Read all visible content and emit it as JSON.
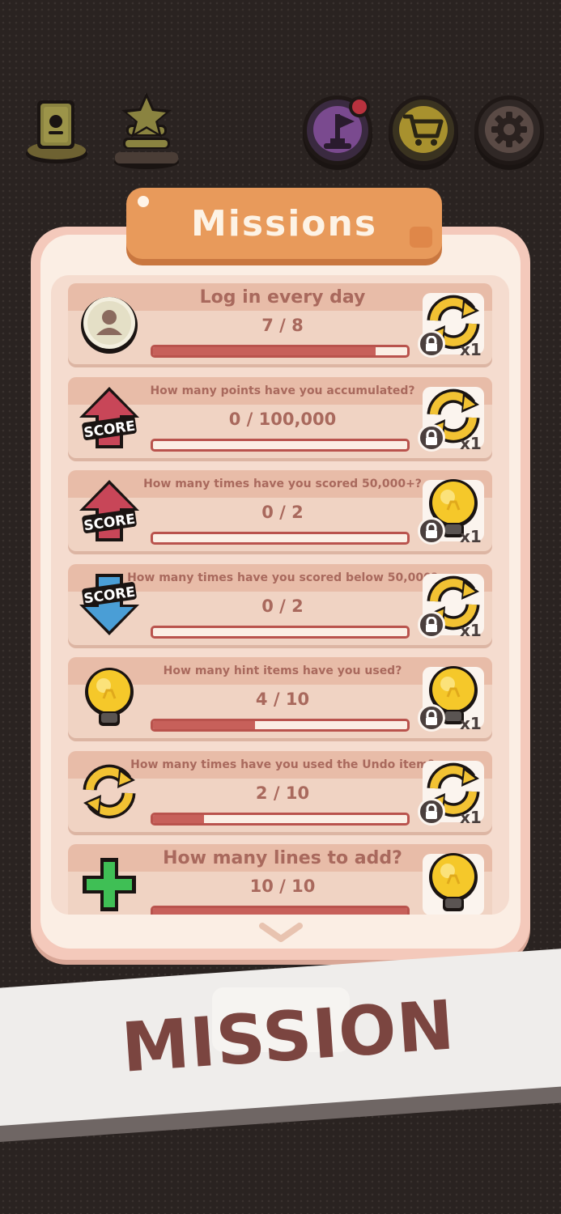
{
  "header": {
    "icons": [
      "profile-card-icon",
      "leaderboard-icon",
      "missions-flag-icon",
      "shop-cart-icon",
      "settings-gear-icon"
    ]
  },
  "panel": {
    "title": "Missions"
  },
  "missions": [
    {
      "label": "Log in every day",
      "label_size": "big",
      "progress": "7 / 8",
      "fraction": 0.875,
      "icon": "profile-icon",
      "reward_icon": "undo-icon",
      "reward_qty": "x1",
      "locked": true
    },
    {
      "label": "How many points have you accumulated?",
      "label_size": "small",
      "progress": "0 / 100,000",
      "fraction": 0,
      "icon": "score-up-arrow-icon",
      "reward_icon": "undo-icon",
      "reward_qty": "x1",
      "locked": true
    },
    {
      "label": "How many times have you scored 50,000+?",
      "label_size": "small",
      "progress": "0 / 2",
      "fraction": 0,
      "icon": "score-up-arrow-icon",
      "reward_icon": "hint-bulb-icon",
      "reward_qty": "x1",
      "locked": true
    },
    {
      "label": "How many times have you scored below 50,000?",
      "label_size": "small",
      "progress": "0 / 2",
      "fraction": 0,
      "icon": "score-down-arrow-icon",
      "reward_icon": "undo-icon",
      "reward_qty": "x1",
      "locked": true
    },
    {
      "label": "How many hint items have you used?",
      "label_size": "small",
      "progress": "4 / 10",
      "fraction": 0.4,
      "icon": "hint-bulb-icon",
      "reward_icon": "hint-bulb-icon",
      "reward_qty": "x1",
      "locked": true
    },
    {
      "label": "How many times have you used the Undo item?",
      "label_size": "small",
      "progress": "2 / 10",
      "fraction": 0.2,
      "icon": "undo-icon",
      "reward_icon": "undo-icon",
      "reward_qty": "x1",
      "locked": true
    },
    {
      "label": "How many lines to add?",
      "label_size": "big",
      "progress": "10 / 10",
      "fraction": 1,
      "icon": "add-line-plus-icon",
      "reward_icon": "hint-bulb-icon",
      "reward_qty": "",
      "locked": false
    }
  ],
  "banner": {
    "text": "MISSION"
  },
  "colors": {
    "background": "#2a2321",
    "panel": "#f4c9bb",
    "title_tab": "#e89a5b",
    "text": "#a9695d",
    "progress_fill": "#c7605a",
    "banner_text": "#7b4540"
  }
}
